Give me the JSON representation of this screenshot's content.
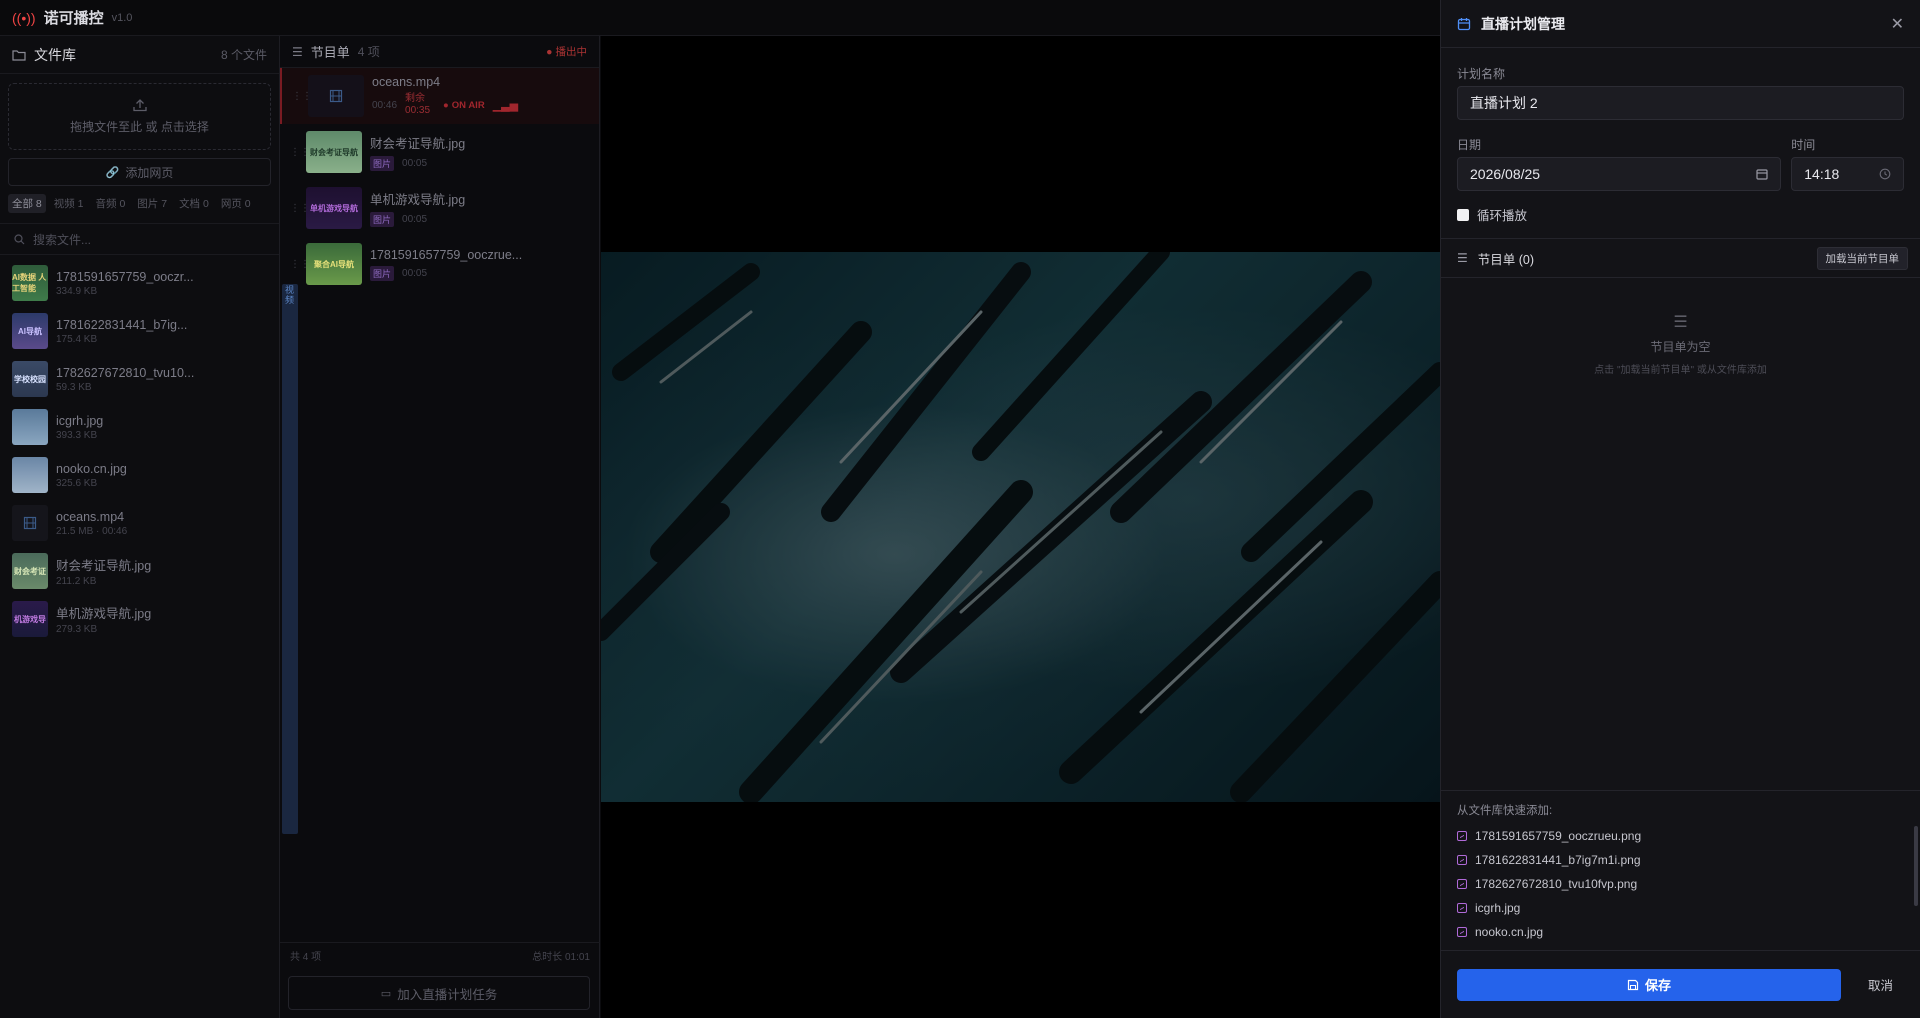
{
  "app": {
    "title": "诺可播控",
    "version": "v1.0"
  },
  "library": {
    "title": "文件库",
    "count": "8 个文件",
    "drop_hint": "拖拽文件至此 或 点击选择",
    "add_web": "添加网页",
    "filters": [
      "全部 8",
      "视频 1",
      "音频 0",
      "图片 7",
      "文档 0",
      "网页 0"
    ],
    "search_placeholder": "搜索文件...",
    "files": [
      {
        "name": "1781591657759_ooczr...",
        "size": "334.9 KB"
      },
      {
        "name": "1781622831441_b7ig...",
        "size": "175.4 KB"
      },
      {
        "name": "1782627672810_tvu10...",
        "size": "59.3 KB"
      },
      {
        "name": "icgrh.jpg",
        "size": "393.3 KB"
      },
      {
        "name": "nooko.cn.jpg",
        "size": "325.6 KB"
      },
      {
        "name": "oceans.mp4",
        "size": "21.5 MB · 00:46"
      },
      {
        "name": "财会考证导航.jpg",
        "size": "211.2 KB"
      },
      {
        "name": "单机游戏导航.jpg",
        "size": "279.3 KB"
      }
    ],
    "thumb_text": [
      "AI数据 人工智能",
      "AI导航",
      "学校校园",
      "",
      "",
      "",
      "财会考证",
      "机游戏导"
    ]
  },
  "playlist": {
    "title": "节目单",
    "count": "4 项",
    "status": "播出中",
    "items": [
      {
        "name": "oceans.mp4",
        "tag": "视频",
        "duration": "00:46",
        "remain": "剩余 00:35",
        "onair": "ON AIR"
      },
      {
        "name": "财会考证导航.jpg",
        "tag": "图片",
        "duration": "00:05",
        "thumb": "财会考证导航"
      },
      {
        "name": "单机游戏导航.jpg",
        "tag": "图片",
        "duration": "00:05",
        "thumb": "单机游戏导航"
      },
      {
        "name": "1781591657759_ooczrue...",
        "tag": "图片",
        "duration": "00:05",
        "thumb": "聚合AI导航"
      }
    ],
    "footer_count": "共 4 项",
    "footer_total": "总时长 01:01",
    "add_task": "加入直播计划任务"
  },
  "drawer": {
    "title": "直播计划管理",
    "name_label": "计划名称",
    "name_value": "直播计划 2",
    "date_label": "日期",
    "date_value": "2026/08/25",
    "time_label": "时间",
    "time_value": "14:18",
    "loop_label": "循环播放",
    "program_title": "节目单 (0)",
    "load_button": "加载当前节目单",
    "empty_title": "节目单为空",
    "empty_hint": "点击 \"加载当前节目单\" 或从文件库添加",
    "quick_title": "从文件库快速添加:",
    "quick_items": [
      "1781591657759_ooczrueu.png",
      "1781622831441_b7ig7m1i.png",
      "1782627672810_tvu10fvp.png",
      "icgrh.jpg",
      "nooko.cn.jpg"
    ],
    "save": "保存",
    "cancel": "取消"
  },
  "colors": {
    "accent": "#2563eb",
    "onair": "#a1262d"
  }
}
